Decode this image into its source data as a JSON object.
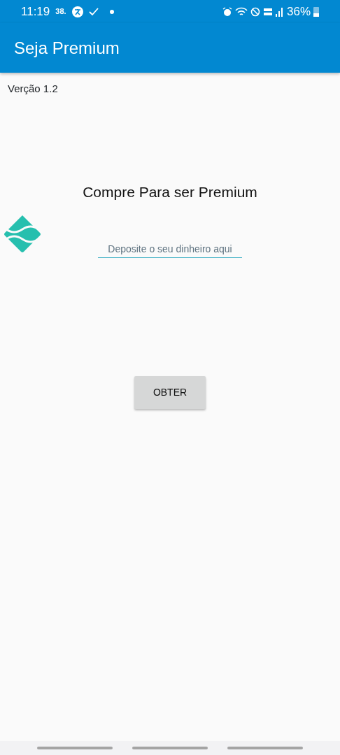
{
  "status_bar": {
    "time": "11:19",
    "notification_text": "38.",
    "battery": "36%"
  },
  "app_bar": {
    "title": "Seja Premium"
  },
  "version": "Verção 1.2",
  "heading": "Compre Para ser Premium",
  "deposit_field": {
    "placeholder": "Deposite o seu dinheiro aqui"
  },
  "button": "OBTER"
}
